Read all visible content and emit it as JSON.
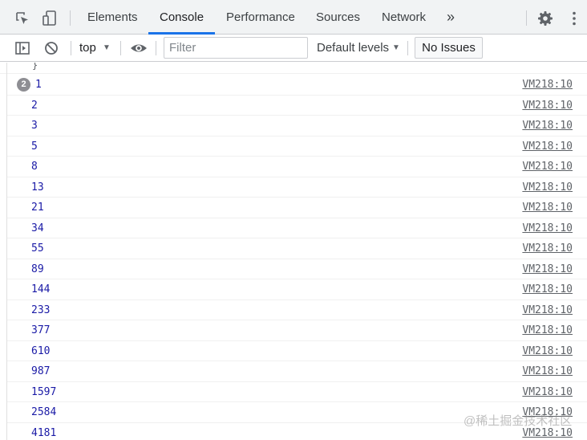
{
  "tabbar": {
    "tabs": [
      {
        "label": "Elements"
      },
      {
        "label": "Console"
      },
      {
        "label": "Performance"
      },
      {
        "label": "Sources"
      },
      {
        "label": "Network"
      }
    ],
    "more": "»",
    "active_index": 1
  },
  "toolbar": {
    "context": "top",
    "filter_placeholder": "Filter",
    "levels_label": "Default levels",
    "issues_label": "No Issues"
  },
  "console": {
    "closing_brace": "}",
    "first_repeat_count": "2",
    "rows": [
      {
        "value": "1",
        "source": "VM218:10"
      },
      {
        "value": "2",
        "source": "VM218:10"
      },
      {
        "value": "3",
        "source": "VM218:10"
      },
      {
        "value": "5",
        "source": "VM218:10"
      },
      {
        "value": "8",
        "source": "VM218:10"
      },
      {
        "value": "13",
        "source": "VM218:10"
      },
      {
        "value": "21",
        "source": "VM218:10"
      },
      {
        "value": "34",
        "source": "VM218:10"
      },
      {
        "value": "55",
        "source": "VM218:10"
      },
      {
        "value": "89",
        "source": "VM218:10"
      },
      {
        "value": "144",
        "source": "VM218:10"
      },
      {
        "value": "233",
        "source": "VM218:10"
      },
      {
        "value": "377",
        "source": "VM218:10"
      },
      {
        "value": "610",
        "source": "VM218:10"
      },
      {
        "value": "987",
        "source": "VM218:10"
      },
      {
        "value": "1597",
        "source": "VM218:10"
      },
      {
        "value": "2584",
        "source": "VM218:10"
      },
      {
        "value": "4181",
        "source": "VM218:10"
      }
    ]
  },
  "watermark": "@稀土掘金技术社区",
  "colors": {
    "accent": "#1a73e8",
    "number": "#1a1aa6",
    "badge": "#8e8e93"
  }
}
